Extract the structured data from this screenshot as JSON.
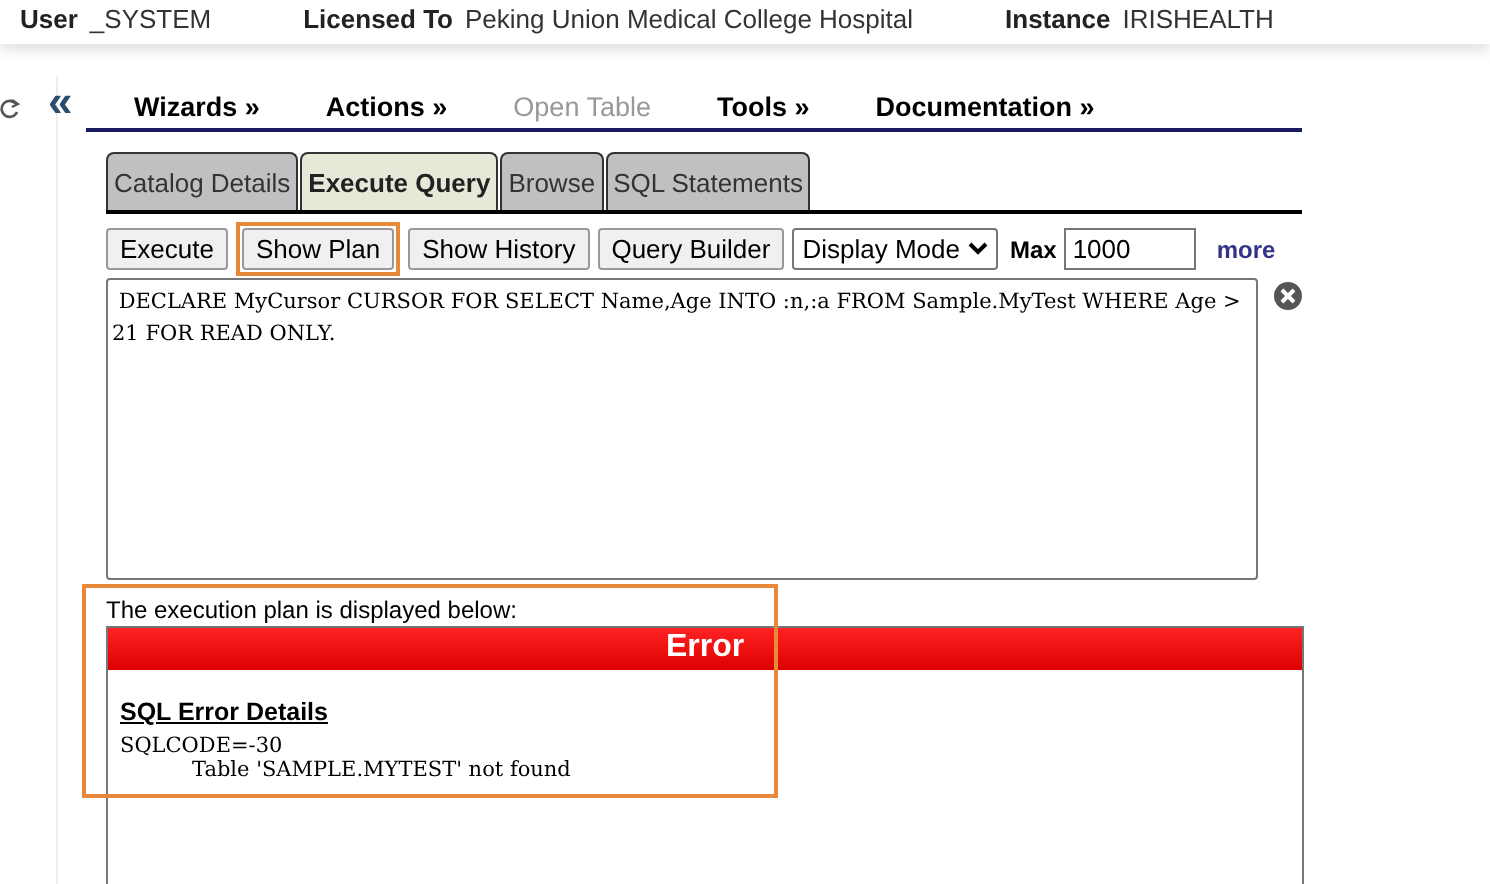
{
  "header": [
    {
      "label": "User",
      "value": "_SYSTEM"
    },
    {
      "label": "Licensed To",
      "value": "Peking Union Medical College Hospital"
    },
    {
      "label": "Instance",
      "value": "IRISHEALTH"
    }
  ],
  "collapse": "«",
  "menu": [
    {
      "label": "Wizards »",
      "disabled": false
    },
    {
      "label": "Actions »",
      "disabled": false
    },
    {
      "label": "Open Table",
      "disabled": true
    },
    {
      "label": "Tools »",
      "disabled": false
    },
    {
      "label": "Documentation »",
      "disabled": false
    }
  ],
  "tabs": [
    {
      "label": "Catalog Details",
      "selected": false
    },
    {
      "label": "Execute Query",
      "selected": true
    },
    {
      "label": "Browse",
      "selected": false
    },
    {
      "label": "SQL Statements",
      "selected": false
    }
  ],
  "toolbar": {
    "buttons": [
      {
        "label": "Execute",
        "highlighted": false
      },
      {
        "label": "Show Plan",
        "highlighted": true
      },
      {
        "label": "Show History",
        "highlighted": false
      },
      {
        "label": "Query Builder",
        "highlighted": false
      }
    ],
    "mode": "Display Mode",
    "max_label": "Max",
    "max_value": "1000",
    "more": "more"
  },
  "query": " DECLARE MyCursor CURSOR FOR SELECT Name,Age INTO :n,:a FROM Sample.MyTest WHERE Age > 21 FOR READ ONLY.",
  "result": {
    "caption": "The execution plan is displayed below:",
    "highlighted": true,
    "title": "Error",
    "details_heading": "SQL Error Details",
    "code": "SQLCODE=-30",
    "message": "Table 'SAMPLE.MYTEST' not found"
  }
}
